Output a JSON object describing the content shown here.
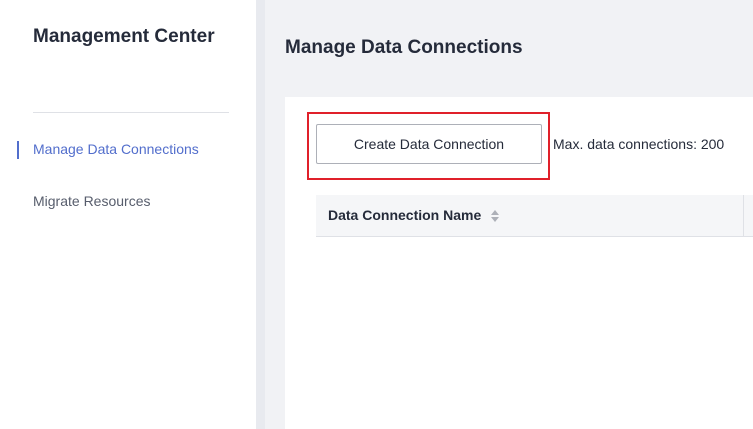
{
  "sidebar": {
    "title": "Management Center",
    "items": [
      {
        "label": "Manage Data Connections",
        "active": true
      },
      {
        "label": "Migrate Resources",
        "active": false
      }
    ]
  },
  "main": {
    "title": "Manage Data Connections",
    "toolbar": {
      "create_label": "Create Data Connection",
      "limit_text": "Max. data connections: 200"
    },
    "table": {
      "columns": [
        {
          "label": "Data Connection Name",
          "icon": "sort-icon"
        }
      ],
      "rows": []
    }
  },
  "colors": {
    "accent": "#526ecc",
    "highlight": "#e0202a",
    "background": "#f1f2f5"
  }
}
